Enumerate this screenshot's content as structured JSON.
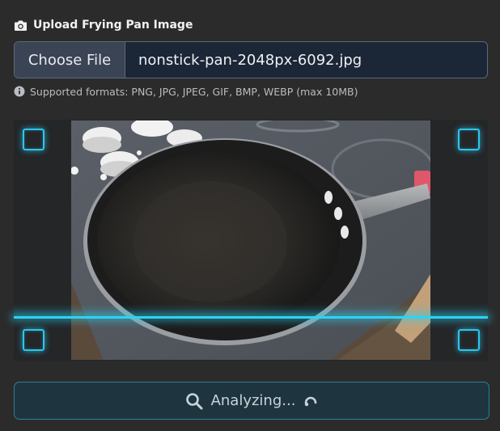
{
  "upload": {
    "label": "Upload Frying Pan Image",
    "choose_label": "Choose File",
    "file_name": "nonstick-pan-2048px-6092.jpg",
    "hint": "Supported formats: PNG, JPG, JPEG, GIF, BMP, WEBP (max 10MB)"
  },
  "preview": {
    "image_description_icon": "frying-pan-photo"
  },
  "action": {
    "label": "Analyzing...",
    "icon": "search-icon",
    "spinner": "spinner-icon"
  },
  "colors": {
    "accent": "#2bc6ec",
    "background": "#2b2b2b",
    "input_bg": "#1b2636"
  }
}
